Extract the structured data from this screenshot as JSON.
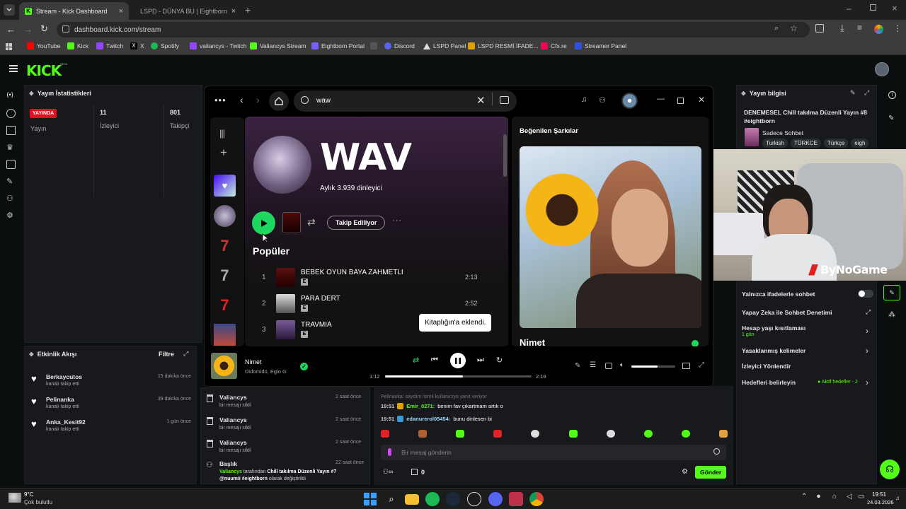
{
  "browser": {
    "tabs": [
      {
        "label": "Stream - Kick Dashboard"
      },
      {
        "label": "LSPD - DÜNYA BU | Eightborn"
      }
    ],
    "url": "dashboard.kick.com/stream",
    "bookmarks": [
      {
        "label": "YouTube"
      },
      {
        "label": "Kick"
      },
      {
        "label": "Twitch"
      },
      {
        "label": "X"
      },
      {
        "label": "Spotify"
      },
      {
        "label": "valiancys - Twitch"
      },
      {
        "label": "Valiancys Stream"
      },
      {
        "label": "Eightborn Portal"
      },
      {
        "label": "Discord"
      },
      {
        "label": "LSPD Panel"
      },
      {
        "label": "LSPD  RESMİ İFADE..."
      },
      {
        "label": "Cfx.re"
      },
      {
        "label": "Streamer Panel"
      }
    ]
  },
  "kick": {
    "logo": "KICK",
    "beta": "BETA",
    "stats": {
      "title": "Yayın İstatistikleri",
      "live_badge": "YAYINDA",
      "live_label": "Yayın",
      "viewers_value": "11",
      "viewers_label": "İzleyici",
      "followers_value": "801",
      "followers_label": "Takipçi"
    },
    "activity": {
      "title": "Etkinlik Akışı",
      "filter": "Filtre",
      "items": [
        {
          "name": "Berkaycutos",
          "desc": "kanalı takip etti",
          "time": "15 dakika önce"
        },
        {
          "name": "Pelinanka",
          "desc": "kanalı takip etti",
          "time": "39 dakika önce"
        },
        {
          "name": "Anka_Kesit92",
          "desc": "kanalı takip etti",
          "time": "1 gün önce"
        }
      ]
    },
    "modlog": {
      "items": [
        {
          "name": "Valiancys",
          "desc": "bir mesajı sildi",
          "time": "2 saat önce"
        },
        {
          "name": "Valiancys",
          "desc": "bir mesajı sildi",
          "time": "2 saat önce"
        },
        {
          "name": "Valiancys",
          "desc": "bir mesajı sildi",
          "time": "2 saat önce"
        }
      ],
      "title_item": {
        "name": "Başlık",
        "time": "22 saat önce",
        "line1_user": "Valiancys",
        "line1_mid": " tarafından ",
        "line1_title": "Chill takılma Düzenli Yayın #7",
        "line2_title": "@nuumii #eightborn",
        "line2_rest": " olarak değiştirildi"
      }
    },
    "chat": {
      "line_pelin": "Pelinanka: saydım isimli kullanıcıya yanıt veriyor",
      "msgs": [
        {
          "time": "19:51",
          "user": "Emir_0271",
          "text": "benim fav çıkartmam artık o"
        },
        {
          "time": "19:51",
          "user": "edanurerol05454",
          "text": "bunu dinlesen bi"
        }
      ],
      "placeholder": "Bir mesaj gönderin",
      "count": "0",
      "send": "Gönder"
    },
    "info": {
      "title": "Yayın bilgisi",
      "stream_title": "DENEMESEL Chill takılma Düzenli Yayın #8 #eightborn",
      "category": "Sadece Sohbet",
      "tags": [
        "Turkish",
        "TÜRKCE",
        "Türkçe",
        "eigh"
      ]
    },
    "settings": [
      {
        "label": "Yalnızca ifadelerle sohbet",
        "type": "toggle"
      },
      {
        "label": "Yapay Zeka ile Sohbet Denetimi",
        "type": "ext"
      },
      {
        "label": "Hesap yaşı kısıtlaması",
        "sub": "1 gün",
        "type": "chev"
      },
      {
        "label": "Yasaklanmış kelimeler",
        "type": "chev"
      },
      {
        "label": "İzleyici Yönlendir",
        "type": "none"
      },
      {
        "label": "Hedefleri belirleyin",
        "badge": "Aktif hedefler - 2",
        "type": "chev"
      }
    ]
  },
  "spotify": {
    "search": "waw",
    "artist": "WAV",
    "listeners": "Aylık 3.939 dinleyici",
    "follow_btn": "Takip Ediliyor",
    "popular": "Popüler",
    "tracks": [
      {
        "n": "1",
        "title": "BEBEK OYUN BAYA ZAHMETLI",
        "dur": "2:13"
      },
      {
        "n": "2",
        "title": "PARA DERT",
        "dur": "2:52"
      },
      {
        "n": "3",
        "title": "TRAVMIA",
        "dur": ""
      }
    ],
    "explicit": "E",
    "toast": "Kitaplığın'a eklendi.",
    "liked_title": "Beğenilen Şarkılar",
    "np_under": "Nimet",
    "now_playing": {
      "title": "Nimet",
      "artist": "Didomido, Eglo G",
      "elapsed": "1:12",
      "total": "2:16",
      "progress": 0.53,
      "volume": 0.6
    }
  },
  "overlay": {
    "watermark": "ByNoGame"
  },
  "taskbar": {
    "temp": "9°C",
    "weather": "Çok bulutlu",
    "time": "19:51",
    "date": "24.03.2026"
  }
}
